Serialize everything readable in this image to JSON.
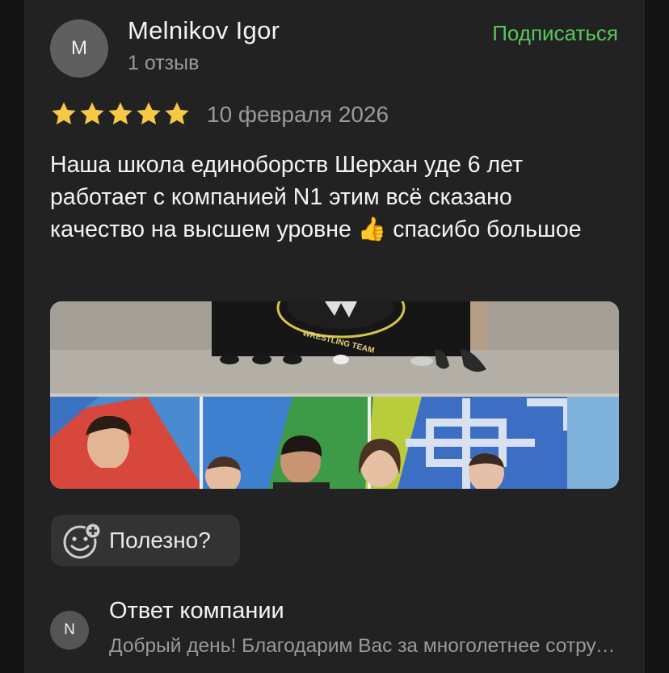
{
  "review": {
    "avatar_letter": "M",
    "author_name": "Melnikov Igor",
    "review_count": "1 отзыв",
    "subscribe_label": "Подписаться",
    "rating": 5,
    "rating_max": 5,
    "star_color": "#f7c843",
    "date": "10 февраля 2026",
    "text": "Наша школа единоборств Шерхан уде 6 лет работает с компанией N1 этим всё сказано качество на высшем уровне 👍 спасибо большое",
    "photo": {
      "banner_text": "WRESTLING TEAM"
    },
    "useful_label": "Полезно?"
  },
  "company_reply": {
    "avatar_letter": "N",
    "title": "Ответ компании",
    "text": "Добрый день! Благодарим Вас за многолетнее сотрудничество"
  },
  "colors": {
    "accent_green": "#57c75d",
    "card_background": "#222222",
    "muted_text": "#9a9a9a"
  }
}
